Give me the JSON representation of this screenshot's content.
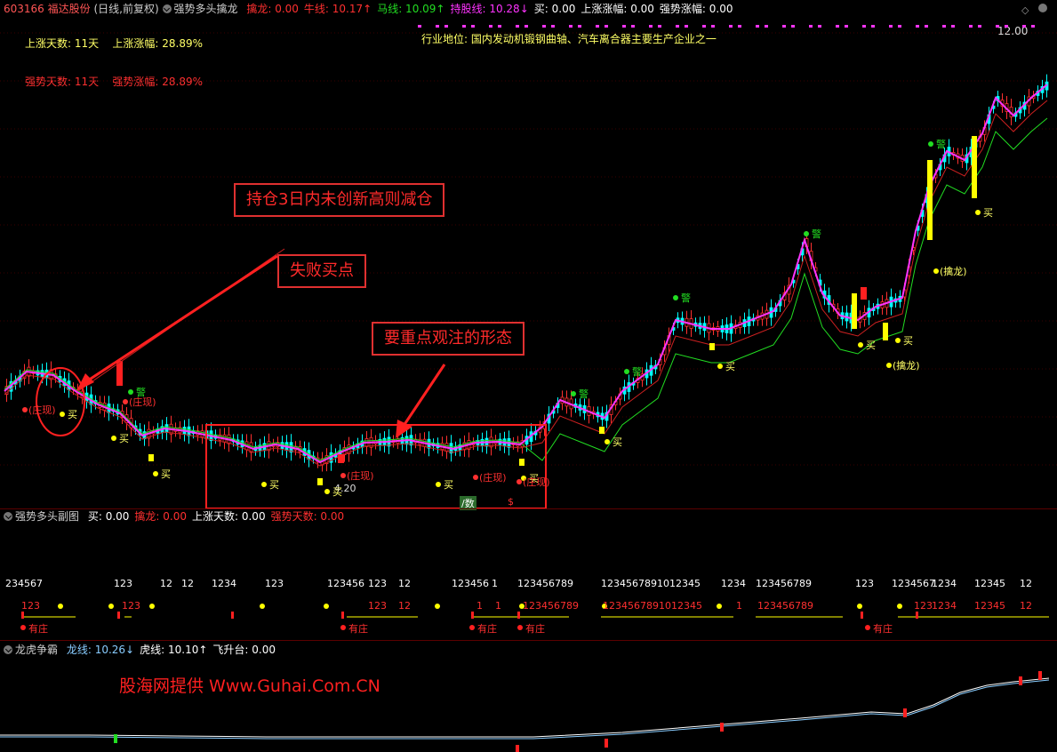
{
  "header": {
    "stock_code": "603166",
    "stock_name": "福达股份",
    "period": "(日线,前复权)",
    "indicator_name": "强势多头擒龙",
    "items": [
      {
        "label": "擒龙:",
        "value": "0.00",
        "color": "#ff3030"
      },
      {
        "label": "牛线:",
        "value": "10.17↑",
        "color": "#ff3030"
      },
      {
        "label": "马线:",
        "value": "10.09↑",
        "color": "#22dd22"
      },
      {
        "label": "持股线:",
        "value": "10.28↓",
        "color": "#ff33ff"
      },
      {
        "label": "买:",
        "value": "0.00",
        "color": "#ffffff"
      },
      {
        "label": "上涨涨幅:",
        "value": "0.00",
        "color": "#ffffff"
      },
      {
        "label": "强势涨幅:",
        "value": "0.00",
        "color": "#ffffff"
      }
    ]
  },
  "main_chart": {
    "price_label": "12.00",
    "info_left_1": "上涨天数: 11天    上涨涨幅: 28.89%",
    "info_left_2": "强势天数: 11天    强势涨幅: 28.89%",
    "industry": "行业地位: 国内发动机锻钢曲轴、汽车离合器主要生产企业之一",
    "low_price_label": "4.20",
    "annotations": {
      "box1": "持仓3日内未创新高则减仓",
      "box2": "失败买点",
      "box3": "要重点观注的形态"
    },
    "buy_label": "买",
    "warn_label": "警",
    "zhuangxian_label": "(庄现)",
    "qinlong_label": "(擒龙)",
    "bottom_markers": [
      "/数",
      "$"
    ]
  },
  "sub_panel_1": {
    "title": "强势多头副图",
    "items": [
      {
        "label": "买:",
        "value": "0.00",
        "color": "#ffffff"
      },
      {
        "label": "擒龙:",
        "value": "0.00",
        "color": "#ff3030"
      },
      {
        "label": "上涨天数:",
        "value": "0.00",
        "color": "#ffffff"
      },
      {
        "label": "强势天数:",
        "value": "0.00",
        "color": "#ff3030"
      }
    ],
    "count_row": [
      "234567",
      "123",
      "12",
      "12",
      "1234",
      "123",
      "123456",
      "123",
      "12",
      "123456",
      "1",
      "123456789",
      "1234567891012345",
      "1234",
      "123456789",
      "123",
      "1234567",
      "1234",
      "12345",
      "12"
    ],
    "count_row2": [
      "123",
      "123",
      "123",
      "12",
      "1",
      "1",
      "123456789",
      "1234567891012345",
      "1",
      "123456789",
      "123",
      "1234",
      "12345",
      "12"
    ],
    "youzhuang_label": "有庄"
  },
  "sub_panel_2": {
    "title": "龙虎争霸",
    "items": [
      {
        "label": "龙线:",
        "value": "10.26↓",
        "color": "#88ccff"
      },
      {
        "label": "虎线:",
        "value": "10.10↑",
        "color": "#ffffff"
      },
      {
        "label": "飞升台:",
        "value": "0.00",
        "color": "#ffffff"
      }
    ],
    "watermark": "股海网提供 Www.Guhai.Com.CN"
  },
  "colors": {
    "up": "#ff3030",
    "down": "#00ffff",
    "hold_line": "#ff33ff",
    "ma_red": "#cc2020",
    "ma_green": "#22dd22",
    "signal_yellow": "#ffff00"
  }
}
